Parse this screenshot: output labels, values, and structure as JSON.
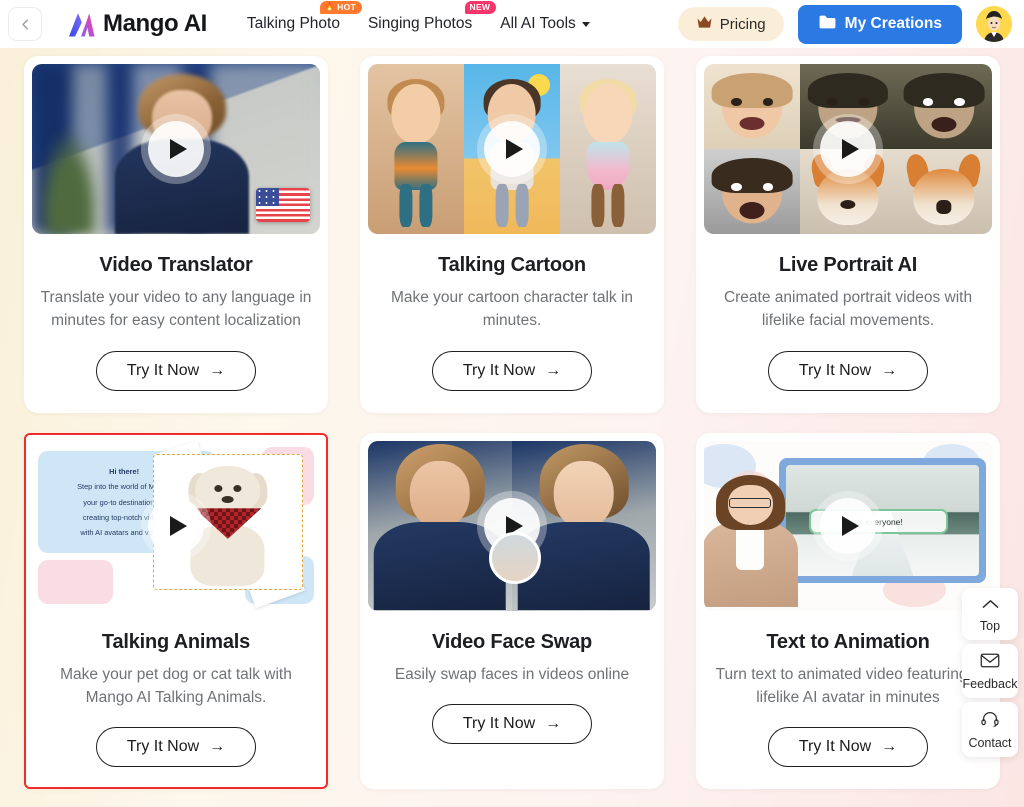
{
  "header": {
    "back_label": "Back",
    "back_icon": "chevron-left-icon",
    "brand": "Mango AI",
    "nav": [
      {
        "label": "Talking Photo",
        "badge": "HOT",
        "badge_type": "hot",
        "has_caret": false
      },
      {
        "label": "Singing Photos",
        "badge": "NEW",
        "badge_type": "new",
        "has_caret": false
      },
      {
        "label": "All AI Tools",
        "badge": "",
        "badge_type": "",
        "has_caret": true
      }
    ],
    "pricing_label": "Pricing",
    "pricing_icon": "crown-icon",
    "creations_label": "My Creations",
    "creations_icon": "folder-icon",
    "avatar_icon": "user-avatar"
  },
  "colors": {
    "brand_blue": "#2b7ae4",
    "hot_badge": "#ff7a2f",
    "new_badge": "#f8366b",
    "pricing_bg": "#fbeed8",
    "selected_border": "#ef2b2b",
    "avatar_bg": "#ffd84d"
  },
  "cards": [
    {
      "id": "video-translator",
      "title": "Video Translator",
      "desc": "Translate your video to any language in minutes for easy content localization",
      "cta": "Try It Now",
      "selected": false,
      "thumb_icon": "play-icon",
      "thumb_badge": "us-flag-icon"
    },
    {
      "id": "talking-cartoon",
      "title": "Talking Cartoon",
      "desc": "Make your cartoon character talk in minutes.",
      "cta": "Try It Now",
      "selected": false,
      "thumb_icon": "play-icon",
      "thumb_badge": ""
    },
    {
      "id": "live-portrait-ai",
      "title": "Live Portrait AI",
      "desc": "Create animated portrait videos with lifelike facial movements.",
      "cta": "Try It Now",
      "selected": false,
      "thumb_icon": "play-icon",
      "thumb_badge": ""
    },
    {
      "id": "talking-animals",
      "title": "Talking Animals",
      "desc": "Make your pet dog or cat talk with Mango AI Talking Animals.",
      "cta": "Try It Now",
      "selected": true,
      "thumb_icon": "play-icon",
      "thumb_badge": "",
      "thumb_text": {
        "line1": "Hi there!",
        "line2": "Step into the world of Mango",
        "line3": "your go-to destination for",
        "line4": "creating top-notch videos",
        "line5": "with AI avatars and voices."
      }
    },
    {
      "id": "video-face-swap",
      "title": "Video Face Swap",
      "desc": "Easily swap faces in videos online",
      "cta": "Try It Now",
      "selected": false,
      "thumb_icon": "play-icon",
      "thumb_badge": ""
    },
    {
      "id": "text-to-animation",
      "title": "Text to Animation",
      "desc": "Turn text to animated video featuring a lifelike AI avatar in minutes",
      "cta": "Try It Now",
      "selected": false,
      "thumb_icon": "play-icon",
      "thumb_badge": "",
      "thumb_caption": "ck,everyone!"
    }
  ],
  "side_widget": [
    {
      "label": "Top",
      "icon": "chevron-up-icon"
    },
    {
      "label": "Feedback",
      "icon": "envelope-icon"
    },
    {
      "label": "Contact",
      "icon": "headset-icon"
    }
  ]
}
